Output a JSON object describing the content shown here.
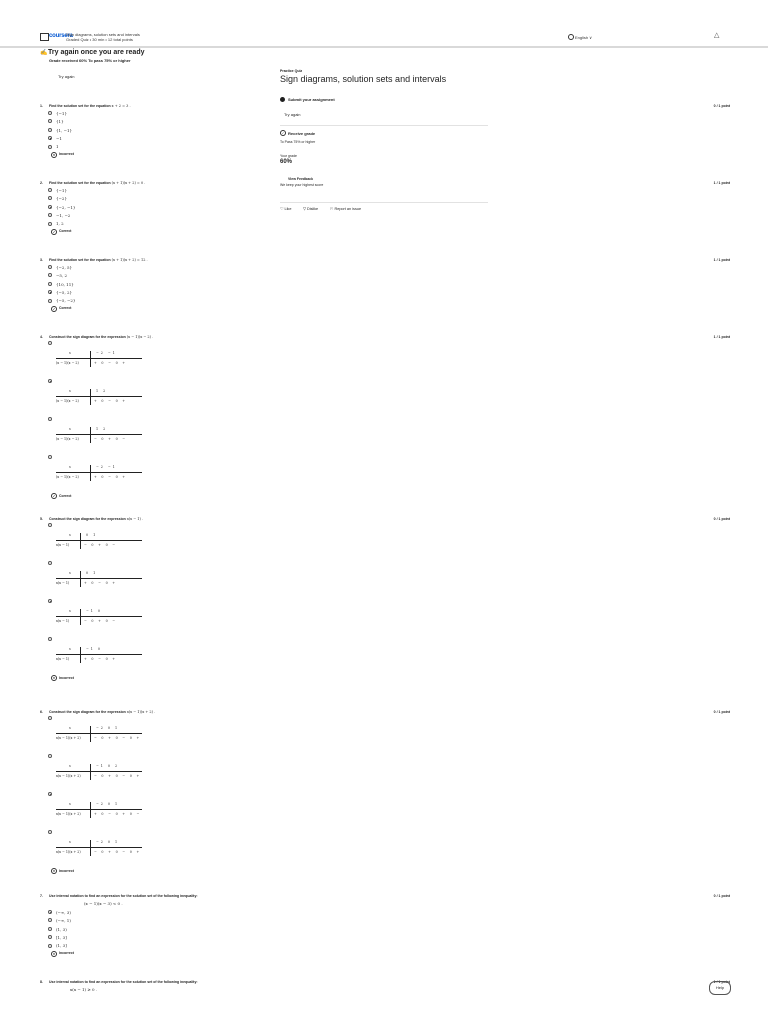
{
  "header": {
    "logo": "coursera",
    "breadcrumb_line1": "Sign diagrams, solution sets and intervals",
    "breadcrumb_line2": "Graded Quiz • 30 min • 12 total points",
    "language": "English",
    "lang_chevron": "∨"
  },
  "banner": {
    "title": "Try again once you are ready",
    "subtitle": "Grade received 60%   To pass 75% or higher",
    "try_again": "Try again"
  },
  "panel": {
    "quiz_type": "Practice Quiz",
    "quiz_title": "Sign diagrams, solution sets and intervals",
    "submit_label": "Submit your assignment",
    "try_again": "Try again",
    "receive_label": "Receive grade",
    "to_pass": "To Pass 75% or higher",
    "your_grade_label": "Your grade",
    "your_grade": "60%",
    "feedback_label": "View Feedback",
    "feedback_sub": "We keep your highest score",
    "like": "Like",
    "dislike": "Dislike",
    "report": "Report an issue"
  },
  "questions": [
    {
      "num": "1.",
      "text": "Find the solution set for the equation",
      "math": "x + 2 = 3 .",
      "points": "0 / 1 point",
      "options": [
        "{−1}",
        "{1}",
        "{1, −1}",
        "−1",
        "1"
      ],
      "selected": 3,
      "status": "Incorrect",
      "status_icon": "✕"
    },
    {
      "num": "2.",
      "text": "Find the solution set for the equation",
      "math": "(x + 1)(x + 2) = 0 .",
      "points": "1 / 1 point",
      "options": [
        "{−1}",
        "{−2}",
        "{−2, −1}",
        "−1, −2",
        "1, 2"
      ],
      "selected": 2,
      "status": "Correct",
      "status_icon": "✓"
    },
    {
      "num": "3.",
      "text": "Find the solution set for the equation",
      "math": "(x + 1)(x + 2) = 12 .",
      "points": "1 / 1 point",
      "options": [
        "{−2, 5}",
        "−5, 2",
        "{10, 11}",
        "{−5, 2}",
        "{−5, −2}"
      ],
      "selected": 3,
      "status": "Correct",
      "status_icon": "✓"
    },
    {
      "num": "4.",
      "text": "Construct the sign diagram for the expression",
      "math": "(x − 1)(x − 2) .",
      "points": "1 / 1 point",
      "diagrams": [
        {
          "x": "x",
          "expr": "(x − 1)(x − 2)",
          "crit": "−2   −1",
          "signs": "+  0  −  0  +"
        },
        {
          "x": "x",
          "expr": "(x − 1)(x − 2)",
          "crit": "1    2",
          "signs": "+  0  −  0  +"
        },
        {
          "x": "x",
          "expr": "(x − 1)(x − 2)",
          "crit": "1    2",
          "signs": "−  0  +  0  −"
        },
        {
          "x": "x",
          "expr": "(x − 1)(x − 2)",
          "crit": "−2   −1",
          "signs": "+  0  −  0  +"
        }
      ],
      "selected": 1,
      "status": "Correct",
      "status_icon": "✓"
    },
    {
      "num": "5.",
      "text": "Construct the sign diagram for the expression",
      "math": "x(x − 1) .",
      "points": "0 / 1 point",
      "diagrams": [
        {
          "x": "x",
          "expr": "x(x − 1)",
          "crit": "0    1",
          "signs": "−  0  +  0  −"
        },
        {
          "x": "x",
          "expr": "x(x − 1)",
          "crit": "0    1",
          "signs": "+  0  −  0  +"
        },
        {
          "x": "x",
          "expr": "x(x − 1)",
          "crit": "−1   0",
          "signs": "−  0  +  0  −"
        },
        {
          "x": "x",
          "expr": "x(x − 1)",
          "crit": "−1   0",
          "signs": "+  0  −  0  +"
        }
      ],
      "selected": 2,
      "status": "Incorrect",
      "status_icon": "✕"
    },
    {
      "num": "6.",
      "text": "Construct the sign diagram for the expression",
      "math": "x(x − 1)(x + 2) .",
      "points": "0 / 1 point",
      "diagrams": [
        {
          "x": "x",
          "expr": "x(x − 1)(x + 2)",
          "crit": "−2   0   1",
          "signs": "−  0  +  0  −  0  +"
        },
        {
          "x": "x",
          "expr": "x(x − 1)(x + 2)",
          "crit": "−1   0   2",
          "signs": "−  0  +  0  −  0  +"
        },
        {
          "x": "x",
          "expr": "x(x − 1)(x + 2)",
          "crit": "−2   0   1",
          "signs": "+  0  −  0  +  0  −"
        },
        {
          "x": "x",
          "expr": "x(x − 1)(x + 2)",
          "crit": "−2   0   1",
          "signs": "−  0  +  0  −  0  +"
        }
      ],
      "selected": 2,
      "status": "Incorrect",
      "status_icon": "✕"
    },
    {
      "num": "7.",
      "text": "Use interval notation to find an expression for the solution set of the following inequality:",
      "inequality": "(x − 1)(x − 3) < 0 .",
      "points": "0 / 1 point",
      "options": [
        "(−∞, 3)",
        "(−∞, 1)",
        "(1, 3)",
        "[1, 3]",
        "(1, 3]"
      ],
      "selected": 0,
      "status": "Incorrect",
      "status_icon": "✕"
    },
    {
      "num": "8.",
      "text": "Use interval notation to find an expression for the solution set of the following inequality:",
      "inequality": "x(x − 1) ≥ 0 .",
      "points": "1 / 1 point"
    }
  ],
  "help": "Help"
}
